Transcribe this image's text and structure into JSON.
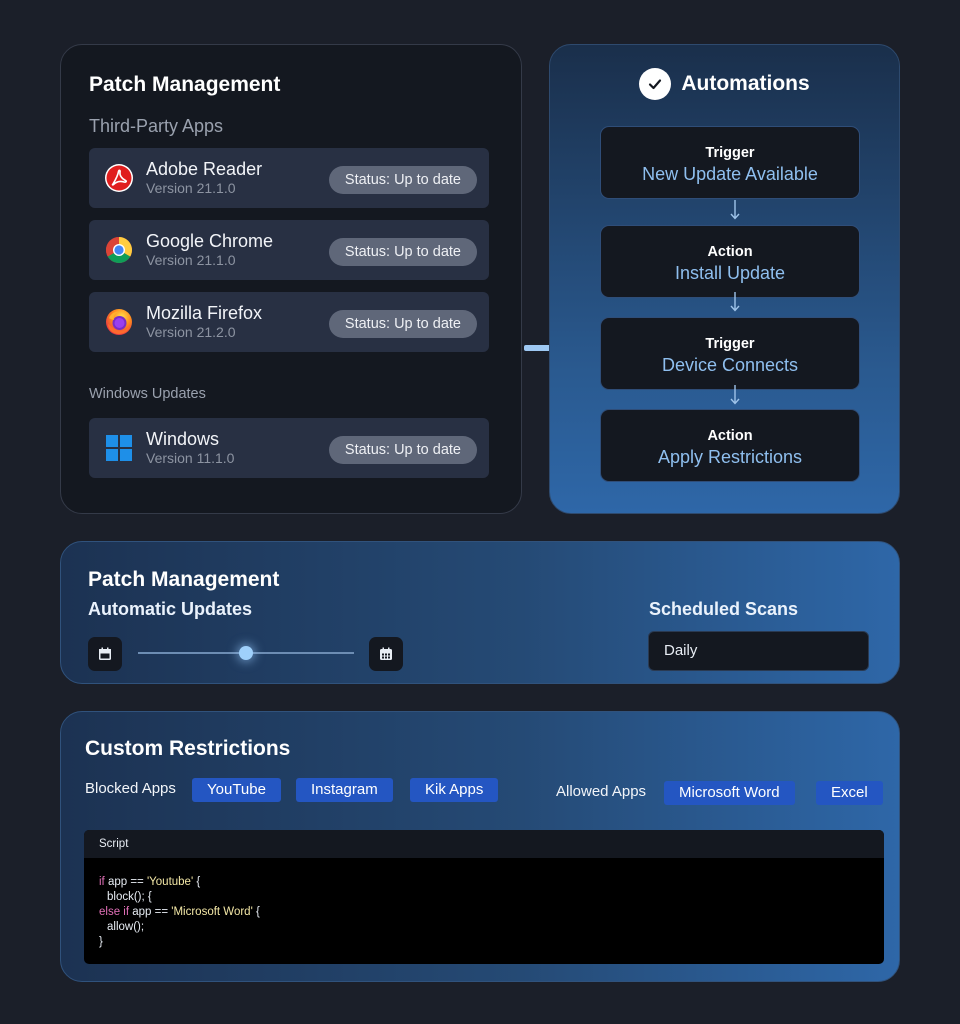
{
  "patch_management": {
    "title": "Patch Management",
    "section_third_party": "Third-Party Apps",
    "section_windows": "Windows Updates",
    "apps": [
      {
        "name": "Adobe Reader",
        "version": "Version 21.1.0",
        "status": "Status: Up to date",
        "icon": "adobe-reader-icon"
      },
      {
        "name": "Google Chrome",
        "version": "Version 21.1.0",
        "status": "Status: Up to date",
        "icon": "chrome-icon"
      },
      {
        "name": "Mozilla Firefox",
        "version": "Version 21.2.0",
        "status": "Status: Up to date",
        "icon": "firefox-icon"
      }
    ],
    "windows": {
      "name": "Windows",
      "version": "Version 11.1.0",
      "status": "Status: Up to date",
      "icon": "windows-icon"
    }
  },
  "automations": {
    "title": "Automations",
    "icon": "check-icon",
    "steps": [
      {
        "kind": "Trigger",
        "label": "New Update Available"
      },
      {
        "kind": "Action",
        "label": "Install Update"
      },
      {
        "kind": "Trigger",
        "label": "Device Connects"
      },
      {
        "kind": "Action",
        "label": "Apply Restrictions"
      }
    ]
  },
  "schedule": {
    "title": "Patch Management",
    "automatic_updates": "Automatic Updates",
    "scheduled_scans": "Scheduled Scans",
    "scan_frequency": "Daily",
    "slider_level": 0.5
  },
  "restrictions": {
    "title": "Custom Restrictions",
    "blocked_label": "Blocked Apps",
    "blocked_apps": [
      "YouTube",
      "Instagram",
      "Kik Apps"
    ],
    "allowed_label": "Allowed Apps",
    "allowed_apps": [
      "Microsoft Word",
      "Excel"
    ],
    "script": {
      "header": "Script",
      "kw_if": "if",
      "line1_mid": " app == ",
      "line1_str": "'Youtube'",
      "line1_end": " {",
      "line2": "block(); {",
      "kw_else_if": "else if",
      "line3_mid": " app == ",
      "line3_str": "'Microsoft Word'",
      "line3_end": " {",
      "line4": "allow();",
      "line5": "}"
    }
  },
  "colors": {
    "background": "#1b1f29",
    "card_dark": "#141820",
    "accent_blue": "#2456c2",
    "step_label": "#8fbfef",
    "status_pill": "#5f6779"
  }
}
